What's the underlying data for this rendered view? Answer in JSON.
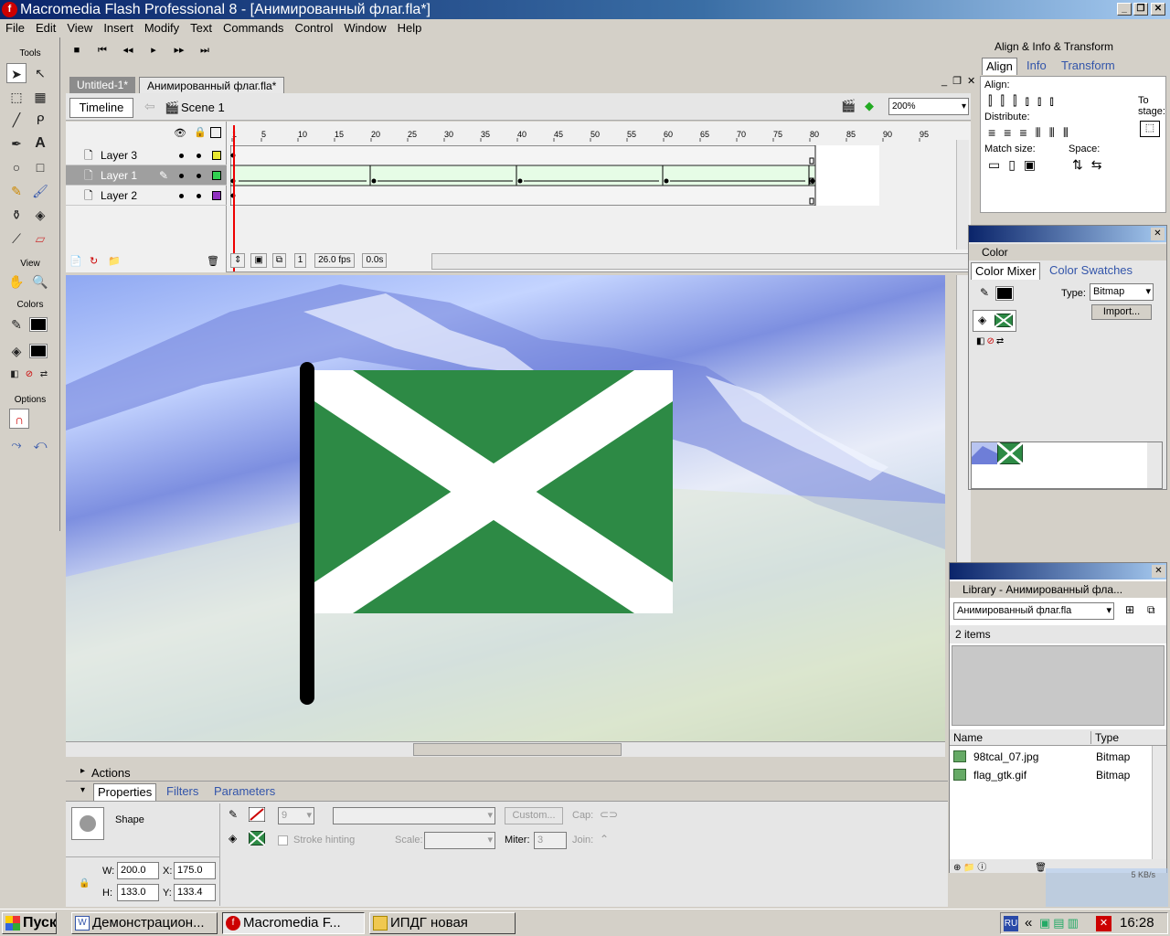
{
  "window": {
    "title": "Macromedia Flash Professional 8 - [Анимированный флаг.fla*]",
    "app_icon": "flash-icon",
    "controls": {
      "minimize": "_",
      "restore": "❐",
      "close": "✕"
    }
  },
  "menu": [
    "File",
    "Edit",
    "View",
    "Insert",
    "Modify",
    "Text",
    "Commands",
    "Control",
    "Window",
    "Help"
  ],
  "tools": {
    "section_tools": "Tools",
    "section_view": "View",
    "section_colors": "Colors",
    "section_options": "Options"
  },
  "control_bar": [
    "■",
    "⏮",
    "◂◂",
    "▸",
    "▸▸",
    "⏭"
  ],
  "doc_tabs": [
    "Untitled-1*",
    "Анимированный флаг.fla*"
  ],
  "edit_bar": {
    "timeline": "Timeline",
    "scene": "Scene 1",
    "zoom": "200%"
  },
  "timeline": {
    "layers": [
      {
        "name": "Layer 3",
        "color": "#e8e830",
        "active": false
      },
      {
        "name": "Layer 1",
        "color": "#30d050",
        "active": true
      },
      {
        "name": "Layer 2",
        "color": "#9030c0",
        "active": false
      }
    ],
    "ruler": [
      "1",
      "5",
      "10",
      "15",
      "20",
      "25",
      "30",
      "35",
      "40",
      "45",
      "50",
      "55",
      "60",
      "65",
      "70",
      "75",
      "80",
      "85",
      "90",
      "95"
    ],
    "tween_keyframes": [
      1,
      20,
      40,
      60,
      80
    ],
    "status": {
      "frame": "1",
      "fps": "26.0 fps",
      "time": "0.0s"
    }
  },
  "stage": {
    "flag_color": "#2d8a45",
    "cross_color": "#ffffff"
  },
  "align_panel": {
    "title": "Align & Info & Transform",
    "tabs": [
      "Align",
      "Info",
      "Transform"
    ],
    "labels": {
      "align": "Align:",
      "distribute": "Distribute:",
      "match": "Match size:",
      "space": "Space:",
      "to": "To",
      "stage": "stage:"
    }
  },
  "color_panel": {
    "title": "Color",
    "tabs": [
      "Color Mixer",
      "Color Swatches"
    ],
    "type_label": "Type:",
    "type_value": "Bitmap",
    "import_label": "Import..."
  },
  "library_panel": {
    "title": "Library - Анимированный фла...",
    "selector": "Анимированный флаг.fla",
    "count": "2 items",
    "columns": [
      "Name",
      "Type"
    ],
    "items": [
      {
        "name": "98tcal_07.jpg",
        "type": "Bitmap"
      },
      {
        "name": "flag_gtk.gif",
        "type": "Bitmap"
      }
    ]
  },
  "actions_panel": {
    "title": "Actions"
  },
  "properties": {
    "tabs": [
      "Properties",
      "Filters",
      "Parameters"
    ],
    "shape_label": "Shape",
    "stroke_size": "9",
    "custom_label": "Custom...",
    "cap_label": "Cap:",
    "stroke_hinting": "Stroke hinting",
    "scale_label": "Scale:",
    "miter_label": "Miter:",
    "miter_value": "3",
    "join_label": "Join:",
    "w_label": "W:",
    "w_value": "200.0",
    "x_label": "X:",
    "x_value": "175.0",
    "h_label": "H:",
    "h_value": "133.0",
    "y_label": "Y:",
    "y_value": "133.4"
  },
  "taskbar": {
    "start": "Пуск",
    "tasks": [
      "Демонстрацион...",
      "Macromedia F...",
      "ИПДГ новая"
    ],
    "lang": "RU",
    "clock": "16:28",
    "net_speed": "5 KB/s"
  }
}
